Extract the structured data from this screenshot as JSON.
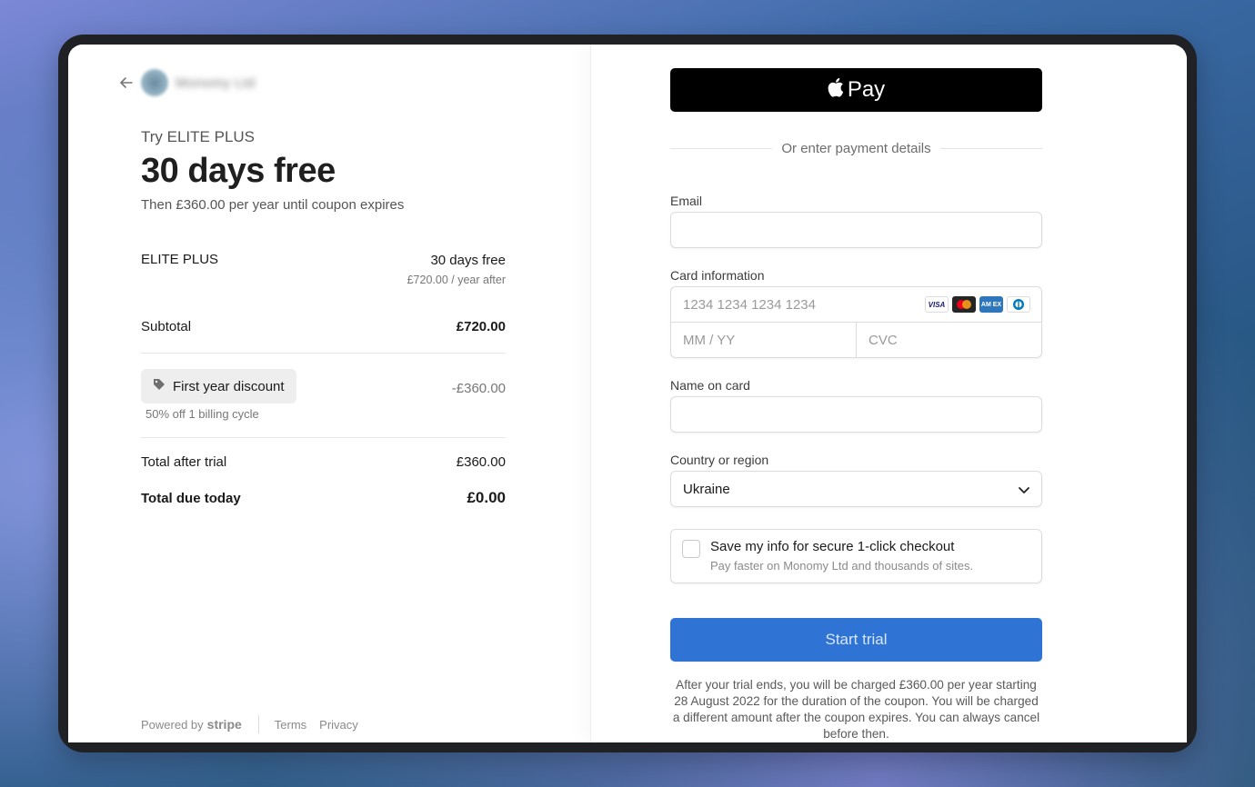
{
  "merchant": {
    "name": "Monomy Ltd"
  },
  "summary": {
    "try_label": "Try ELITE PLUS",
    "headline": "30 days free",
    "then_text": "Then £360.00 per year until coupon expires"
  },
  "line_item": {
    "name": "ELITE PLUS",
    "amount": "30 days free",
    "sub": "£720.00 / year after"
  },
  "subtotal": {
    "label": "Subtotal",
    "value": "£720.00"
  },
  "discount": {
    "label": "First year discount",
    "note": "50% off 1 billing cycle",
    "value": "-£360.00"
  },
  "total_after_trial": {
    "label": "Total after trial",
    "value": "£360.00"
  },
  "total_due_today": {
    "label": "Total due today",
    "value": "£0.00"
  },
  "footer": {
    "powered_by": "Powered by",
    "brand": "stripe",
    "terms": "Terms",
    "privacy": "Privacy"
  },
  "payment": {
    "apple_pay_label": "Pay",
    "or_text": "Or enter payment details",
    "email_label": "Email",
    "email_value": "",
    "card_label": "Card information",
    "card_number_placeholder": "1234 1234 1234 1234",
    "expiry_placeholder": "MM / YY",
    "cvc_placeholder": "CVC",
    "card_brands": [
      "visa",
      "mastercard",
      "amex",
      "diners"
    ],
    "name_label": "Name on card",
    "name_value": "",
    "country_label": "Country or region",
    "country_value": "Ukraine",
    "save_title": "Save my info for secure 1-click checkout",
    "save_sub": "Pay faster on Monomy Ltd and thousands of sites.",
    "save_checked": false,
    "submit_label": "Start trial",
    "terms_note": "After your trial ends, you will be charged £360.00 per year starting 28 August 2022 for the duration of the coupon. You will be charged a different amount after the coupon expires. You can always cancel before then."
  },
  "colors": {
    "primary_button": "#2f74d4",
    "apple_pay": "#000000"
  }
}
